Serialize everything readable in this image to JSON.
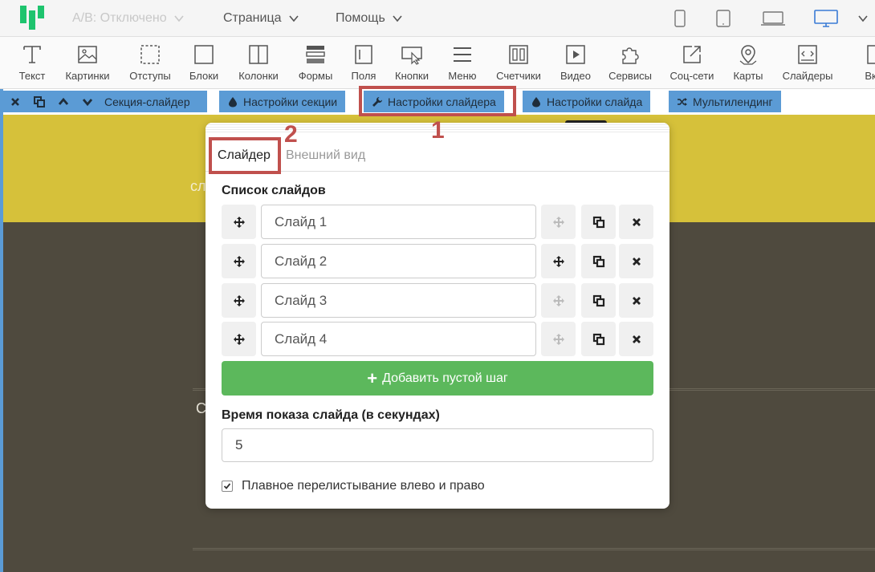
{
  "topbar": {
    "ab_label": "A/B: Отключено",
    "page_label": "Страница",
    "help_label": "Помощь",
    "devices": [
      "phone-icon",
      "tablet-icon",
      "laptop-icon",
      "desktop-icon"
    ],
    "active_device": "desktop-icon"
  },
  "toolbar": {
    "items": [
      {
        "label": "Текст",
        "icon": "text-icon"
      },
      {
        "label": "Картинки",
        "icon": "image-icon"
      },
      {
        "label": "Отступы",
        "icon": "spacing-icon"
      },
      {
        "label": "Блоки",
        "icon": "block-icon"
      },
      {
        "label": "Колонки",
        "icon": "columns-icon"
      },
      {
        "label": "Формы",
        "icon": "form-icon"
      },
      {
        "label": "Поля",
        "icon": "field-icon"
      },
      {
        "label": "Кнопки",
        "icon": "button-icon"
      },
      {
        "label": "Меню",
        "icon": "menu-icon"
      },
      {
        "label": "Счетчики",
        "icon": "counter-icon"
      },
      {
        "label": "Видео",
        "icon": "video-icon"
      },
      {
        "label": "Сервисы",
        "icon": "puzzle-icon"
      },
      {
        "label": "Соц-сети",
        "icon": "share-icon"
      },
      {
        "label": "Карты",
        "icon": "map-pin-icon"
      },
      {
        "label": "Слайдеры",
        "icon": "slider-icon"
      },
      {
        "label": "Вкла",
        "icon": "tab-icon"
      }
    ]
  },
  "sectionbar": {
    "section_label": "Секция-слайдер",
    "section_settings": "Настройки секции",
    "slider_settings": "Настройки слайдера",
    "slide_settings": "Настройки слайда",
    "multilanding": "Мультилендинг"
  },
  "annotations": {
    "one": "1",
    "two": "2"
  },
  "popup": {
    "tabs": {
      "slider": "Слайдер",
      "appearance": "Внешний вид"
    },
    "slides_title": "Список слайдов",
    "slides": [
      "Слайд 1",
      "Слайд 2",
      "Слайд 3",
      "Слайд 4"
    ],
    "add_button": "Добавить пустой шаг",
    "time_label": "Время показа слайда (в секундах)",
    "time_value": "5",
    "smooth_label": "Плавное перелистывание влево и право",
    "smooth_checked": true
  },
  "colors": {
    "accent_blue": "#5b9bd5",
    "highlight_red": "#c0504d",
    "add_green": "#5cb85c",
    "section_yellow": "#d6c13a",
    "section_dark": "#4f4a3e",
    "logo_green": "#1ec46e"
  }
}
